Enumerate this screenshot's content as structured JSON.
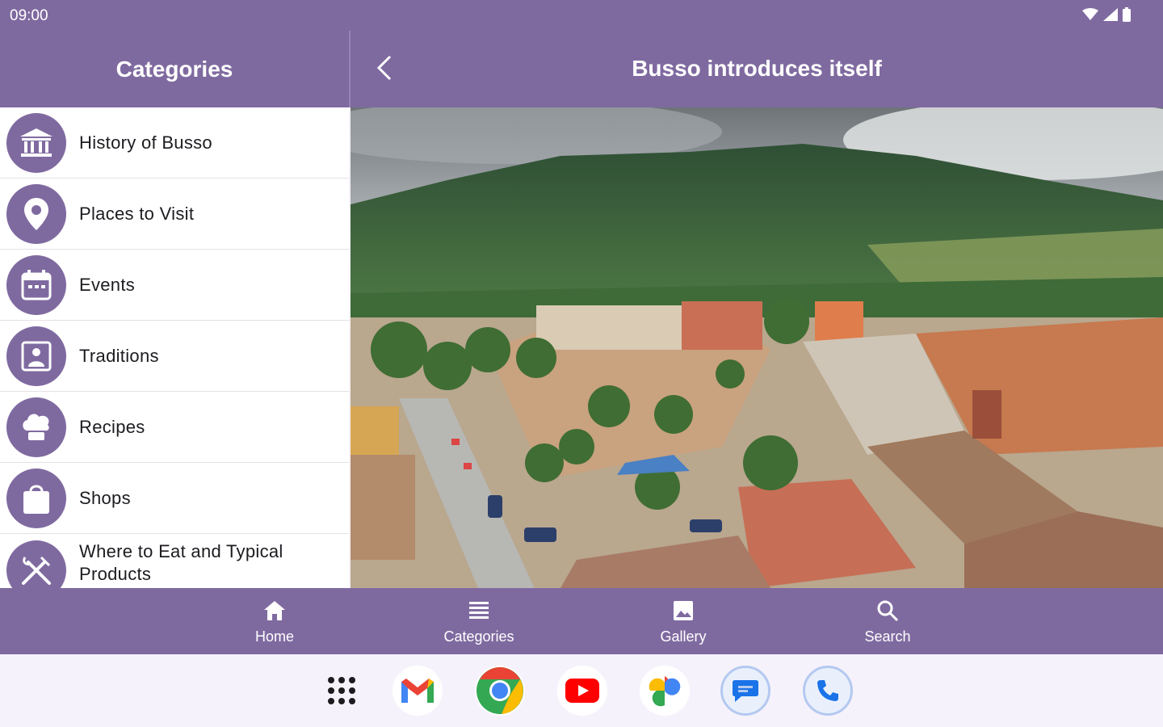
{
  "status": {
    "time": "09:00"
  },
  "left": {
    "title": "Categories",
    "items": [
      {
        "label": "History of Busso",
        "icon": "museum-icon"
      },
      {
        "label": "Places to Visit",
        "icon": "location-pin-icon"
      },
      {
        "label": "Events",
        "icon": "calendar-icon"
      },
      {
        "label": "Traditions",
        "icon": "portrait-icon"
      },
      {
        "label": "Recipes",
        "icon": "chef-hat-icon"
      },
      {
        "label": "Shops",
        "icon": "shopping-bag-icon"
      },
      {
        "label": "Where to Eat and Typical Products",
        "icon": "fork-knife-icon"
      }
    ]
  },
  "detail": {
    "title": "Busso introduces itself",
    "image_alt": "Aerial view of Busso town square with mountains"
  },
  "bottom_nav": {
    "home": "Home",
    "categories": "Categories",
    "gallery": "Gallery",
    "search": "Search"
  },
  "dock": {
    "apps": [
      "app-drawer",
      "gmail",
      "chrome",
      "youtube",
      "photos",
      "messages",
      "phone"
    ]
  },
  "colors": {
    "accent": "#7f6aa0",
    "surface": "#ffffff",
    "dock_bg": "#f6f2fb"
  }
}
